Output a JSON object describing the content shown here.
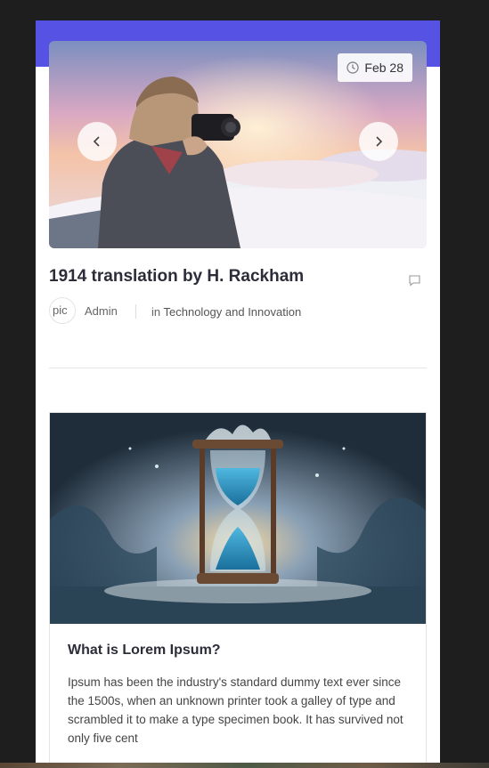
{
  "post": {
    "date": "Feb 28",
    "title": "1914 translation by H. Rackham",
    "avatar_text": "pic",
    "author": "Admin",
    "category_prefix": "in",
    "category": "Technology and Innovation",
    "icons": {
      "date": "clock-icon",
      "prev": "chevron-left-icon",
      "next": "chevron-right-icon",
      "comment": "comment-icon"
    }
  },
  "card": {
    "title": "What is Lorem Ipsum?",
    "excerpt": "Ipsum has been the industry's standard dummy text ever since the 1500s, when an unknown printer took a galley of type and scrambled it to make a type specimen book. It has survived not only five cent"
  },
  "colors": {
    "accent": "#5552e4",
    "background": "#1e1e1e",
    "title": "#2d2d3a"
  }
}
